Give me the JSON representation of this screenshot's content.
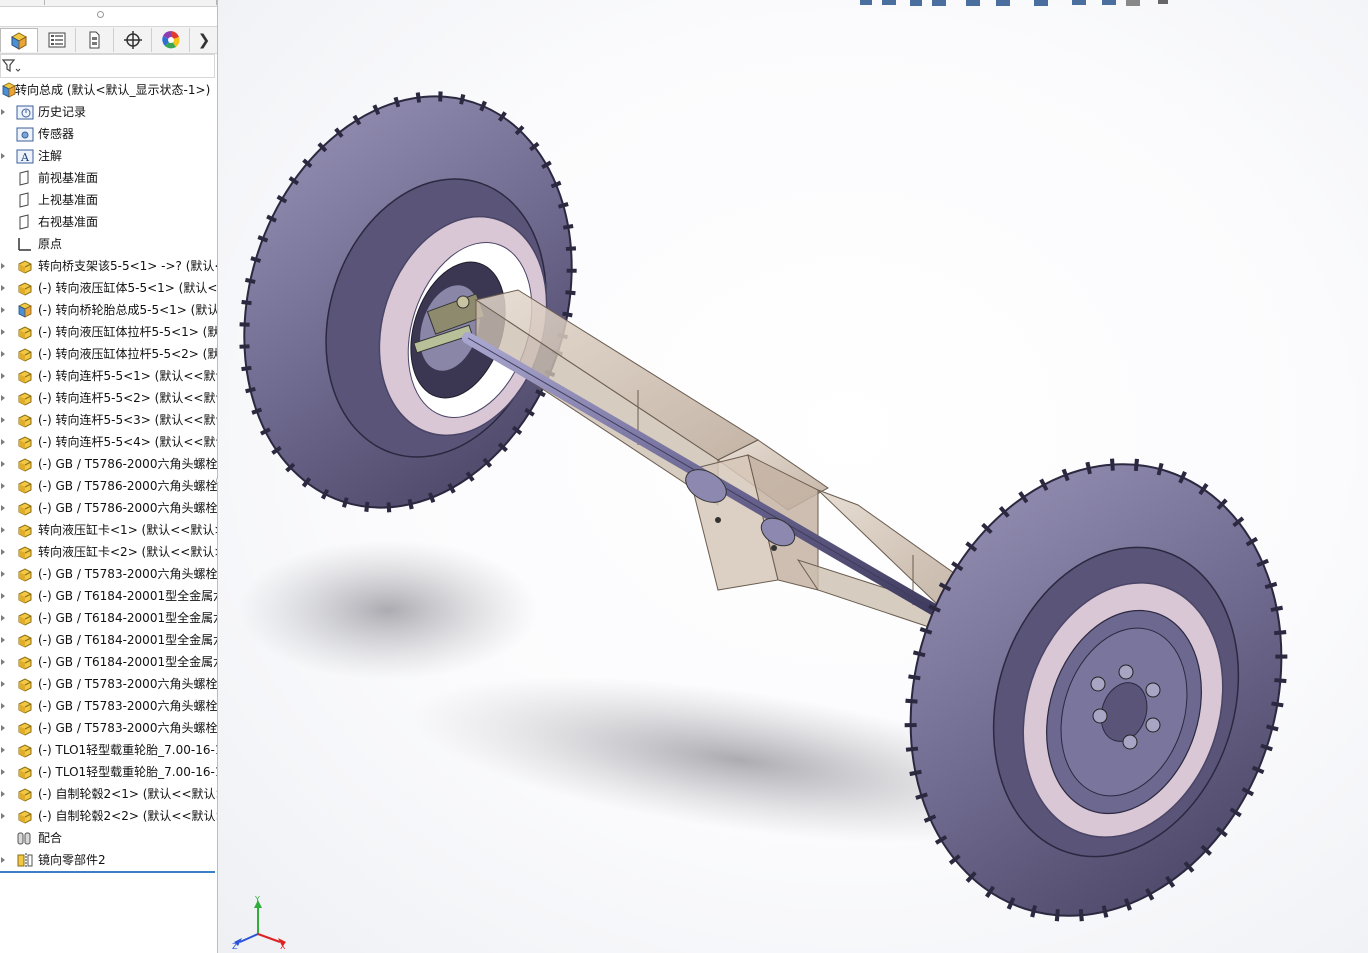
{
  "feature_tree": {
    "root": {
      "label": "转向总成 (默认<默认_显示状态-1>)"
    },
    "items": [
      {
        "label": "历史记录",
        "icon": "history-folder-icon",
        "expandable": true
      },
      {
        "label": "传感器",
        "icon": "sensor-folder-icon",
        "expandable": false
      },
      {
        "label": "注解",
        "icon": "annotation-folder-icon",
        "expandable": true
      },
      {
        "label": "前视基准面",
        "icon": "plane-icon",
        "expandable": false
      },
      {
        "label": "上视基准面",
        "icon": "plane-icon",
        "expandable": false
      },
      {
        "label": "右视基准面",
        "icon": "plane-icon",
        "expandable": false
      },
      {
        "label": "原点",
        "icon": "origin-icon",
        "expandable": false
      },
      {
        "label": "转向桥支架该5-5<1> ->? (默认<",
        "icon": "part-icon",
        "expandable": true
      },
      {
        "label": "(-) 转向液压缸体5-5<1> (默认<",
        "icon": "part-icon",
        "expandable": true
      },
      {
        "label": "(-) 转向桥轮胎总成5-5<1> (默认",
        "icon": "subassembly-icon",
        "expandable": true
      },
      {
        "label": "(-) 转向液压缸体拉杆5-5<1> (默",
        "icon": "part-icon",
        "expandable": true
      },
      {
        "label": "(-) 转向液压缸体拉杆5-5<2> (默",
        "icon": "part-icon",
        "expandable": true
      },
      {
        "label": "(-) 转向连杆5-5<1> (默认<<默认",
        "icon": "part-icon",
        "expandable": true
      },
      {
        "label": "(-) 转向连杆5-5<2> (默认<<默认",
        "icon": "part-icon",
        "expandable": true
      },
      {
        "label": "(-) 转向连杆5-5<3> (默认<<默认",
        "icon": "part-icon",
        "expandable": true
      },
      {
        "label": "(-) 转向连杆5-5<4> (默认<<默认",
        "icon": "part-icon",
        "expandable": true
      },
      {
        "label": "(-) GB / T5786-2000六角头螺栓",
        "icon": "part-icon",
        "expandable": true
      },
      {
        "label": "(-) GB / T5786-2000六角头螺栓",
        "icon": "part-icon",
        "expandable": true
      },
      {
        "label": "(-) GB / T5786-2000六角头螺栓",
        "icon": "part-icon",
        "expandable": true
      },
      {
        "label": "转向液压缸卡<1> (默认<<默认>",
        "icon": "part-icon",
        "expandable": true
      },
      {
        "label": "转向液压缸卡<2> (默认<<默认>",
        "icon": "part-icon",
        "expandable": true
      },
      {
        "label": "(-) GB / T5783-2000六角头螺栓",
        "icon": "part-icon",
        "expandable": true
      },
      {
        "label": "(-) GB / T6184-20001型全金属六",
        "icon": "part-icon",
        "expandable": true
      },
      {
        "label": "(-) GB / T6184-20001型全金属六",
        "icon": "part-icon",
        "expandable": true
      },
      {
        "label": "(-) GB / T6184-20001型全金属六",
        "icon": "part-icon",
        "expandable": true
      },
      {
        "label": "(-) GB / T6184-20001型全金属六",
        "icon": "part-icon",
        "expandable": true
      },
      {
        "label": "(-) GB / T5783-2000六角头螺栓",
        "icon": "part-icon",
        "expandable": true
      },
      {
        "label": "(-) GB / T5783-2000六角头螺栓",
        "icon": "part-icon",
        "expandable": true
      },
      {
        "label": "(-) GB / T5783-2000六角头螺栓",
        "icon": "part-icon",
        "expandable": true
      },
      {
        "label": "(-) TLO1轻型载重轮胎_7.00-16-1",
        "icon": "part-icon",
        "expandable": true
      },
      {
        "label": "(-) TLO1轻型载重轮胎_7.00-16-1",
        "icon": "part-icon",
        "expandable": true
      },
      {
        "label": "(-) 自制轮毂2<1> (默认<<默认>",
        "icon": "part-icon",
        "expandable": true
      },
      {
        "label": "(-) 自制轮毂2<2> (默认<<默认>",
        "icon": "part-icon",
        "expandable": true
      },
      {
        "label": "配合",
        "icon": "mates-icon",
        "expandable": false
      },
      {
        "label": "镜向零部件2",
        "icon": "mirror-component-icon",
        "expandable": true
      }
    ]
  },
  "tabs": [
    {
      "name": "feature-manager-tab",
      "icon": "assembly-tree-icon"
    },
    {
      "name": "property-manager-tab",
      "icon": "property-list-icon"
    },
    {
      "name": "configuration-manager-tab",
      "icon": "configuration-icon"
    },
    {
      "name": "dimxpert-manager-tab",
      "icon": "crosshair-icon"
    },
    {
      "name": "display-manager-tab",
      "icon": "color-wheel-icon"
    }
  ],
  "triad": {
    "x": "X",
    "y": "Y",
    "z": "Z"
  },
  "colors": {
    "tire": "#6f6a8f",
    "tire_dark": "#4a4566",
    "rim_ring": "#d9c7d6",
    "frame": "#c9b9a8",
    "rod": "#6e6a96",
    "tree_accent": "#3b7fc4"
  }
}
